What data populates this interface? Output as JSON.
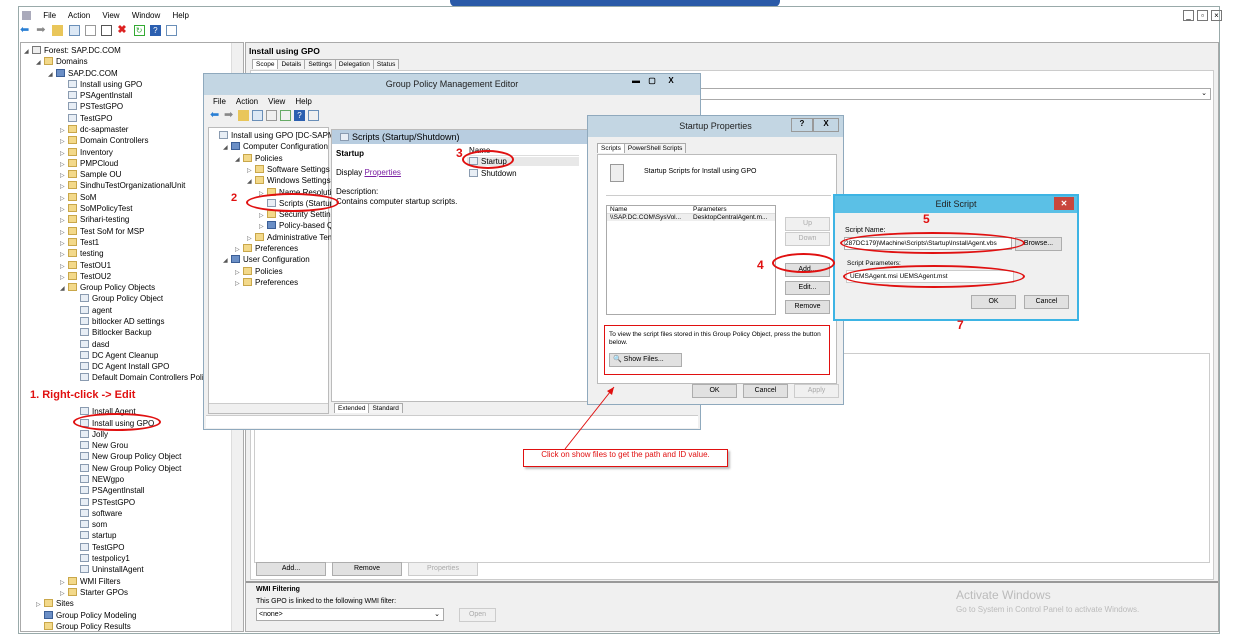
{
  "app": {
    "menu": [
      "File",
      "Action",
      "View",
      "Window",
      "Help"
    ]
  },
  "left_tree": [
    {
      "label": "Forest: SAP.DC.COM",
      "level": 0,
      "exp": "◢",
      "icon": "forest"
    },
    {
      "label": "Domains",
      "level": 1,
      "exp": "◢",
      "icon": "folder"
    },
    {
      "label": "SAP.DC.COM",
      "level": 2,
      "exp": "◢",
      "icon": "domain"
    },
    {
      "label": "Install using GPO",
      "level": 3,
      "exp": "",
      "icon": "gpo"
    },
    {
      "label": "PSAgentInstall",
      "level": 3,
      "exp": "",
      "icon": "gpo"
    },
    {
      "label": "PSTestGPO",
      "level": 3,
      "exp": "",
      "icon": "gpo"
    },
    {
      "label": "TestGPO",
      "level": 3,
      "exp": "",
      "icon": "gpo"
    },
    {
      "label": "dc-sapmaster",
      "level": 3,
      "exp": "▷",
      "icon": "folder"
    },
    {
      "label": "Domain Controllers",
      "level": 3,
      "exp": "▷",
      "icon": "folder"
    },
    {
      "label": "Inventory",
      "level": 3,
      "exp": "▷",
      "icon": "folder"
    },
    {
      "label": "PMPCloud",
      "level": 3,
      "exp": "▷",
      "icon": "folder"
    },
    {
      "label": "Sample OU",
      "level": 3,
      "exp": "▷",
      "icon": "folder"
    },
    {
      "label": "SindhuTestOrganizationalUnit",
      "level": 3,
      "exp": "▷",
      "icon": "folder"
    },
    {
      "label": "SoM",
      "level": 3,
      "exp": "▷",
      "icon": "folder"
    },
    {
      "label": "SoMPolicyTest",
      "level": 3,
      "exp": "▷",
      "icon": "folder"
    },
    {
      "label": "Srihari-testing",
      "level": 3,
      "exp": "▷",
      "icon": "folder"
    },
    {
      "label": "Test SoM for MSP",
      "level": 3,
      "exp": "▷",
      "icon": "folder"
    },
    {
      "label": "Test1",
      "level": 3,
      "exp": "▷",
      "icon": "folder"
    },
    {
      "label": "testing",
      "level": 3,
      "exp": "▷",
      "icon": "folder"
    },
    {
      "label": "TestOU1",
      "level": 3,
      "exp": "▷",
      "icon": "folder"
    },
    {
      "label": "TestOU2",
      "level": 3,
      "exp": "▷",
      "icon": "folder"
    },
    {
      "label": "Group Policy Objects",
      "level": 3,
      "exp": "◢",
      "icon": "folder"
    },
    {
      "label": "Group Policy Object",
      "level": 4,
      "exp": "",
      "icon": "gpo"
    },
    {
      "label": "agent",
      "level": 4,
      "exp": "",
      "icon": "gpo"
    },
    {
      "label": "bitlocker AD settings",
      "level": 4,
      "exp": "",
      "icon": "gpo"
    },
    {
      "label": "Bitlocker Backup",
      "level": 4,
      "exp": "",
      "icon": "gpo"
    },
    {
      "label": "dasd",
      "level": 4,
      "exp": "",
      "icon": "gpo"
    },
    {
      "label": "DC Agent Cleanup",
      "level": 4,
      "exp": "",
      "icon": "gpo"
    },
    {
      "label": "DC Agent Install GPO",
      "level": 4,
      "exp": "",
      "icon": "gpo"
    },
    {
      "label": "Default Domain Controllers Policy",
      "level": 4,
      "exp": "",
      "icon": "gpo"
    },
    {
      "label": "",
      "level": 4,
      "exp": "",
      "icon": "none"
    },
    {
      "label": "",
      "level": 4,
      "exp": "",
      "icon": "none"
    },
    {
      "label": "Install Agent",
      "level": 4,
      "exp": "",
      "icon": "gpo"
    },
    {
      "label": "Install using GPO",
      "level": 4,
      "exp": "",
      "icon": "gpo"
    },
    {
      "label": "Jolly",
      "level": 4,
      "exp": "",
      "icon": "gpo"
    },
    {
      "label": "New Grou",
      "level": 4,
      "exp": "",
      "icon": "gpo"
    },
    {
      "label": "New Group Policy Object",
      "level": 4,
      "exp": "",
      "icon": "gpo"
    },
    {
      "label": "New Group Policy Object",
      "level": 4,
      "exp": "",
      "icon": "gpo"
    },
    {
      "label": "NEWgpo",
      "level": 4,
      "exp": "",
      "icon": "gpo"
    },
    {
      "label": "PSAgentInstall",
      "level": 4,
      "exp": "",
      "icon": "gpo"
    },
    {
      "label": "PSTestGPO",
      "level": 4,
      "exp": "",
      "icon": "gpo"
    },
    {
      "label": "software",
      "level": 4,
      "exp": "",
      "icon": "gpo"
    },
    {
      "label": "som",
      "level": 4,
      "exp": "",
      "icon": "gpo"
    },
    {
      "label": "startup",
      "level": 4,
      "exp": "",
      "icon": "gpo"
    },
    {
      "label": "TestGPO",
      "level": 4,
      "exp": "",
      "icon": "gpo"
    },
    {
      "label": "testpolicy1",
      "level": 4,
      "exp": "",
      "icon": "gpo"
    },
    {
      "label": "UninstallAgent",
      "level": 4,
      "exp": "",
      "icon": "gpo"
    },
    {
      "label": "WMI Filters",
      "level": 3,
      "exp": "▷",
      "icon": "folder"
    },
    {
      "label": "Starter GPOs",
      "level": 3,
      "exp": "▷",
      "icon": "folder"
    },
    {
      "label": "Sites",
      "level": 1,
      "exp": "▷",
      "icon": "folder"
    },
    {
      "label": "Group Policy Modeling",
      "level": 1,
      "exp": "",
      "icon": "cfg"
    },
    {
      "label": "Group Policy Results",
      "level": 1,
      "exp": "",
      "icon": "folder"
    }
  ],
  "right_pane": {
    "title": "Install using GPO",
    "tabs": [
      "Scope",
      "Details",
      "Settings",
      "Delegation",
      "Status"
    ],
    "buttons": {
      "add": "Add...",
      "remove": "Remove",
      "properties": "Properties"
    },
    "wmi": {
      "heading": "WMI Filtering",
      "text": "This GPO is linked to the following WMI filter:",
      "value": "<none>",
      "open": "Open"
    }
  },
  "gpme": {
    "title": "Group Policy Management Editor",
    "menu": [
      "File",
      "Action",
      "View",
      "Help"
    ],
    "tree": [
      {
        "label": "Install using GPO [DC-SAPMAS",
        "level": 0,
        "exp": "",
        "icon": "gpo"
      },
      {
        "label": "Computer Configuration",
        "level": 1,
        "exp": "◢",
        "icon": "cfg"
      },
      {
        "label": "Policies",
        "level": 2,
        "exp": "◢",
        "icon": "folder"
      },
      {
        "label": "Software Settings",
        "level": 3,
        "exp": "▷",
        "icon": "folder"
      },
      {
        "label": "Windows Settings",
        "level": 3,
        "exp": "◢",
        "icon": "folder"
      },
      {
        "label": "Name Resolution",
        "level": 4,
        "exp": "▷",
        "icon": "folder"
      },
      {
        "label": "Scripts (Startup/S",
        "level": 4,
        "exp": "",
        "icon": "gpo"
      },
      {
        "label": "Security Settings",
        "level": 4,
        "exp": "▷",
        "icon": "folder"
      },
      {
        "label": "Policy-based QoS",
        "level": 4,
        "exp": "▷",
        "icon": "cfg"
      },
      {
        "label": "Administrative Temp",
        "level": 3,
        "exp": "▷",
        "icon": "folder"
      },
      {
        "label": "Preferences",
        "level": 2,
        "exp": "▷",
        "icon": "folder"
      },
      {
        "label": "User Configuration",
        "level": 1,
        "exp": "◢",
        "icon": "cfg"
      },
      {
        "label": "Policies",
        "level": 2,
        "exp": "▷",
        "icon": "folder"
      },
      {
        "label": "Preferences",
        "level": 2,
        "exp": "▷",
        "icon": "folder"
      }
    ],
    "pane_header": "Scripts (Startup/Shutdown)",
    "section": "Startup",
    "display": "Display",
    "properties_link": "Properties",
    "description_label": "Description:",
    "description": "Contains computer startup scripts.",
    "name_col": "Name",
    "items": [
      "Startup",
      "Shutdown"
    ],
    "view_tabs": [
      "Extended",
      "Standard"
    ]
  },
  "startup_props": {
    "title": "Startup Properties",
    "help": "?",
    "close": "X",
    "tabs": [
      "Scripts",
      "PowerShell Scripts"
    ],
    "heading": "Startup Scripts for Install using GPO",
    "cols": [
      "Name",
      "Parameters"
    ],
    "row": [
      "\\\\SAP.DC.COM\\SysVol...",
      "DesktopCentralAgent.m..."
    ],
    "buttons": {
      "up": "Up",
      "down": "Down",
      "add": "Add...",
      "edit": "Edit...",
      "remove": "Remove"
    },
    "info": "To view the script files stored in this Group Policy Object, press the button below.",
    "show_files": "Show Files...",
    "ok": "OK",
    "cancel": "Cancel",
    "apply": "Apply"
  },
  "edit_script": {
    "title": "Edit Script",
    "name_label": "Script Name:",
    "name_value": "287DC179}\\Machine\\Scripts\\Startup\\InstallAgent.vbs",
    "browse": "Browse...",
    "params_label": "Script Parameters:",
    "params_value": "UEMSAgent.msi UEMSAgent.mst",
    "ok": "OK",
    "cancel": "Cancel"
  },
  "annotations": {
    "step1": "1. Right-click -> Edit",
    "step2": "2",
    "step3": "3",
    "step4": "4",
    "step5": "5",
    "step7": "7",
    "callout": "Click on show files to get the path and ID value."
  },
  "watermark": {
    "title": "Activate Windows",
    "sub": "Go to System in Control Panel to activate Windows."
  },
  "colors": {
    "annotation": "#e01010",
    "title_bar": "#c3d6e3",
    "edit_title": "#5bc0e6"
  }
}
